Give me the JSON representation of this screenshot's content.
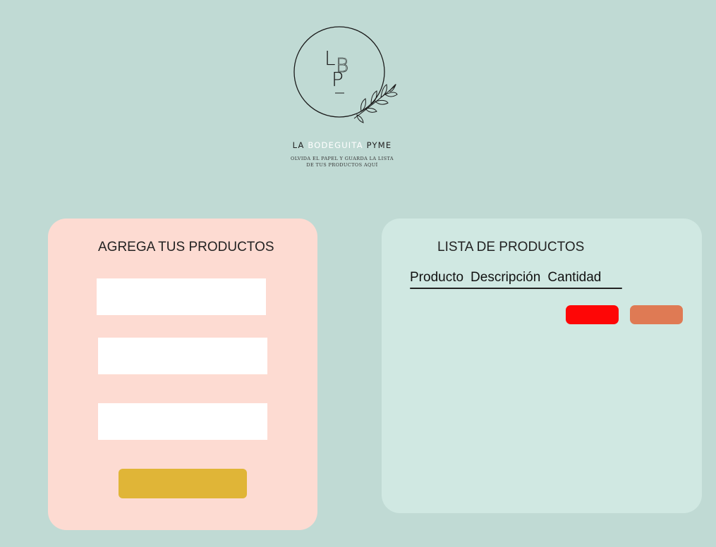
{
  "brand": {
    "name_part1": "LA",
    "name_part2": "BODEGUITA",
    "name_part3": "PYME",
    "tagline_line1": "OLVIDA EL PAPEL Y GUARDA LA LISTA",
    "tagline_line2": "DE TUS PRODUCTOS AQUÍ",
    "logo_letters": [
      "L",
      "B",
      "P"
    ]
  },
  "form": {
    "title": "AGREGA TUS PRODUCTOS",
    "fields": [
      {
        "value": "",
        "placeholder": ""
      },
      {
        "value": "",
        "placeholder": ""
      },
      {
        "value": "",
        "placeholder": ""
      }
    ],
    "submit_label": ""
  },
  "list": {
    "title": "LISTA DE PRODUCTOS",
    "columns": [
      "Producto",
      "Descripción",
      "Cantidad"
    ],
    "delete_label": "",
    "edit_label": ""
  },
  "colors": {
    "background": "#c0dad4",
    "form_panel": "#fddbd2",
    "list_panel": "#d0e8e2",
    "submit_button": "#e0b537",
    "red_button": "#fe0606",
    "orange_button": "#df7a54"
  }
}
